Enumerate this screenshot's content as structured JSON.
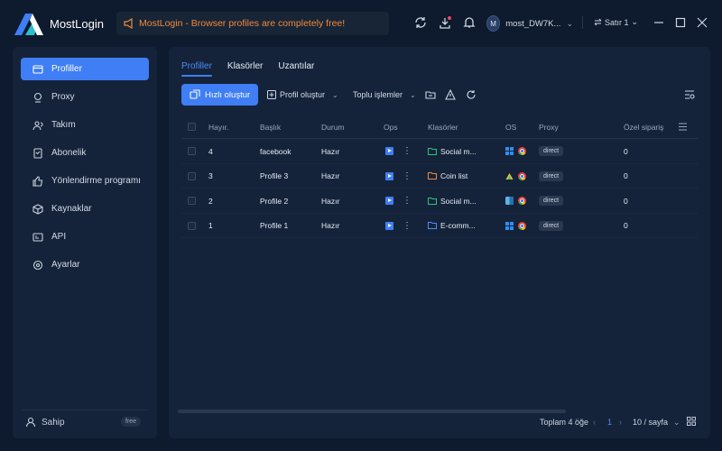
{
  "app": {
    "name": "MostLogin"
  },
  "notice": {
    "text": "MostLogin - Browser profiles are completely free!"
  },
  "user": {
    "initial": "M",
    "name": "most_DW7K..."
  },
  "lang": {
    "label": "Satır 1"
  },
  "sidebar": {
    "items": [
      {
        "label": "Profiller",
        "icon": "profile-icon",
        "active": true
      },
      {
        "label": "Proxy",
        "icon": "proxy-icon"
      },
      {
        "label": "Takım",
        "icon": "team-icon"
      },
      {
        "label": "Abonelik",
        "icon": "subscription-icon"
      },
      {
        "label": "Yönlendirme programı",
        "icon": "referral-icon"
      },
      {
        "label": "Kaynaklar",
        "icon": "resources-icon"
      },
      {
        "label": "API",
        "icon": "api-icon"
      },
      {
        "label": "Ayarlar",
        "icon": "settings-icon"
      }
    ],
    "owner": {
      "label": "Sahip",
      "badge": "free"
    }
  },
  "tabs": [
    "Profiller",
    "Klasörler",
    "Uzantılar"
  ],
  "toolbar": {
    "quick_create": "Hızlı oluştur",
    "create_profile": "Profil oluştur",
    "bulk_ops": "Toplu işlemler"
  },
  "table": {
    "headers": {
      "no": "Hayır.",
      "title": "Başlık",
      "status": "Durum",
      "ops": "Ops",
      "folders": "Klasörler",
      "os": "OS",
      "proxy": "Proxy",
      "custom_order": "Özel sipariş"
    },
    "rows": [
      {
        "no": "4",
        "title": "facebook",
        "status": "Hazır",
        "folder": "Social m...",
        "folder_color": "#2dbf8a",
        "os": "windows",
        "proxy": "direct",
        "order": "0"
      },
      {
        "no": "3",
        "title": "Profile 3",
        "status": "Hazır",
        "folder": "Coin list",
        "folder_color": "#f08a3c",
        "os": "android",
        "proxy": "direct",
        "order": "0"
      },
      {
        "no": "2",
        "title": "Profile 2",
        "status": "Hazır",
        "folder": "Social m...",
        "folder_color": "#2dbf8a",
        "os": "macos",
        "proxy": "direct",
        "order": "0"
      },
      {
        "no": "1",
        "title": "Profile 1",
        "status": "Hazır",
        "folder": "E-comm...",
        "folder_color": "#4b8cf7",
        "os": "windows",
        "proxy": "direct",
        "order": "0"
      }
    ]
  },
  "footer": {
    "total": "Toplam 4 öğe",
    "page": "1",
    "prev": "‹",
    "next": "›",
    "page_size": "10 / sayfa"
  },
  "colors": {
    "accent": "#3f7ef5",
    "warning": "#f08a3c",
    "bg": "#0e1a2d",
    "panel": "#15233a"
  }
}
